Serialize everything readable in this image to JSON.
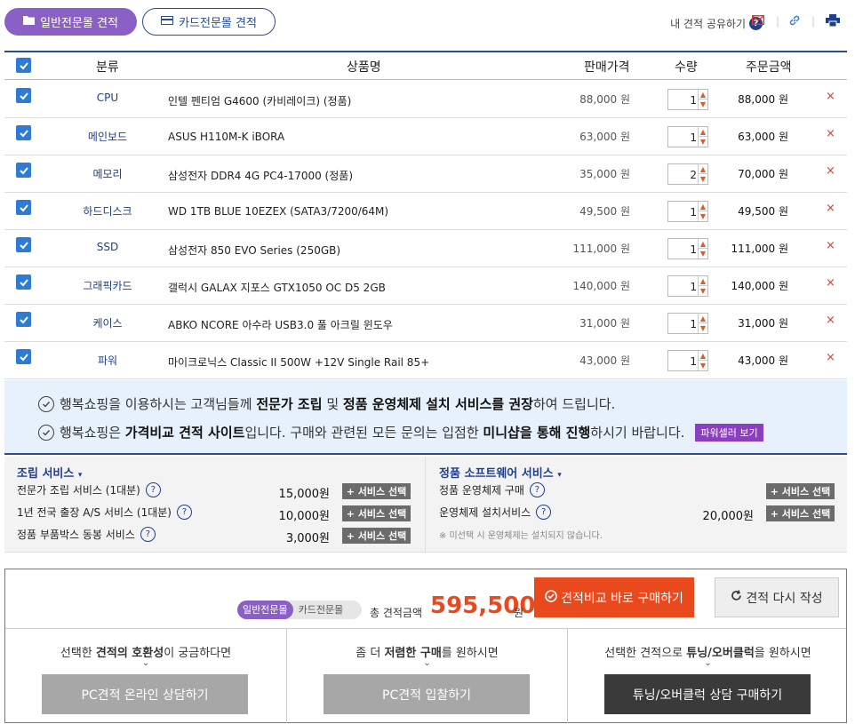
{
  "top": {
    "tab_general": "일반전문몰 견적",
    "tab_card": "카드전문몰 견적",
    "share_label": "내 견적 공유하기",
    "share_help": "?"
  },
  "header": {
    "category": "분류",
    "product": "상품명",
    "price": "판매가격",
    "qty": "수량",
    "total": "주문금액"
  },
  "items": [
    {
      "category": "CPU",
      "name": "인텔 펜티엄 G4600 (카비레이크) (정품)",
      "price": "88,000 원",
      "qty": "1",
      "total": "88,000 원"
    },
    {
      "category": "메인보드",
      "name": "ASUS H110M-K iBORA",
      "price": "63,000 원",
      "qty": "1",
      "total": "63,000 원"
    },
    {
      "category": "메모리",
      "name": "삼성전자 DDR4 4G PC4-17000 (정품)",
      "price": "35,000 원",
      "qty": "2",
      "total": "70,000 원"
    },
    {
      "category": "하드디스크",
      "name": "WD 1TB BLUE 10EZEX (SATA3/7200/64M)",
      "price": "49,500 원",
      "qty": "1",
      "total": "49,500 원"
    },
    {
      "category": "SSD",
      "name": "삼성전자 850 EVO Series (250GB)",
      "price": "111,000 원",
      "qty": "1",
      "total": "111,000 원"
    },
    {
      "category": "그래픽카드",
      "name": "갤럭시 GALAX 지포스 GTX1050 OC D5 2GB",
      "price": "140,000 원",
      "qty": "1",
      "total": "140,000 원"
    },
    {
      "category": "케이스",
      "name": "ABKO NCORE 아수라 USB3.0 풀 아크릴 윈도우",
      "price": "31,000 원",
      "qty": "1",
      "total": "31,000 원"
    },
    {
      "category": "파워",
      "name": "마이크로닉스 Classic II 500W +12V Single Rail 85+",
      "price": "43,000 원",
      "qty": "1",
      "total": "43,000 원"
    }
  ],
  "notice": {
    "l1_a": "행복쇼핑을 이용하시는 고객님들께 ",
    "l1_b": "전문가 조립",
    "l1_c": " 및 ",
    "l1_d": "정품 운영체제 설치 서비스를 권장",
    "l1_e": "하여 드립니다.",
    "l2_a": "행복쇼핑은 ",
    "l2_b": "가격비교 견적 사이트",
    "l2_c": "입니다. 구매와 관련된 모든 문의는 입점한 ",
    "l2_d": "미니샵을 통해 진행",
    "l2_e": "하시기 바랍니다.",
    "l2_btn": "파워셀러 보기"
  },
  "assembly": {
    "title": "조립 서비스",
    "rows": [
      {
        "label": "전문가 조립 서비스 (1대분)",
        "price": "15,000원",
        "btn": "+ 서비스 선택"
      },
      {
        "label": "1년 전국 출장 A/S 서비스 (1대분)",
        "price": "10,000원",
        "btn": "+ 서비스 선택"
      },
      {
        "label": "정품 부품박스 동봉 서비스",
        "price": "3,000원",
        "btn": "+ 서비스 선택"
      }
    ]
  },
  "software": {
    "title": "정품 소프트웨어 서비스",
    "rows": [
      {
        "label": "정품 운영체제 구매",
        "price": "",
        "btn": "+ 서비스 선택"
      },
      {
        "label": "운영체제 설치서비스",
        "price": "20,000원",
        "btn": "+ 서비스 선택"
      }
    ],
    "note": "※ 미선택 시 운영체제는 설치되지 않습니다."
  },
  "summary": {
    "pill_active": "일반전문몰",
    "pill_inactive": "카드전문몰",
    "total_label": "총 견적금액",
    "total_value": "595,500",
    "total_unit": "원",
    "buy_btn": "견적비교 바로 구매하기",
    "rewrite_btn": "견적 다시 작성"
  },
  "bottom_cols": [
    {
      "t_a": "선택한 ",
      "t_b": "견적의 호환성",
      "t_c": "이 궁금하다면",
      "btn": "PC견적 온라인 상담하기"
    },
    {
      "t_a": "좀 더 ",
      "t_b": "저렴한 구매",
      "t_c": "를 원하시면",
      "btn": "PC견적 입찰하기"
    },
    {
      "t_a": "선택한 견적으로 ",
      "t_b": "튜닝/오버클럭",
      "t_c": "을 원하시면",
      "btn": "튜닝/오버클럭 상담 구매하기"
    }
  ],
  "colors": {
    "accent_purple": "#8a5fc6",
    "navy": "#2a4d8f",
    "orange": "#e8491d"
  }
}
